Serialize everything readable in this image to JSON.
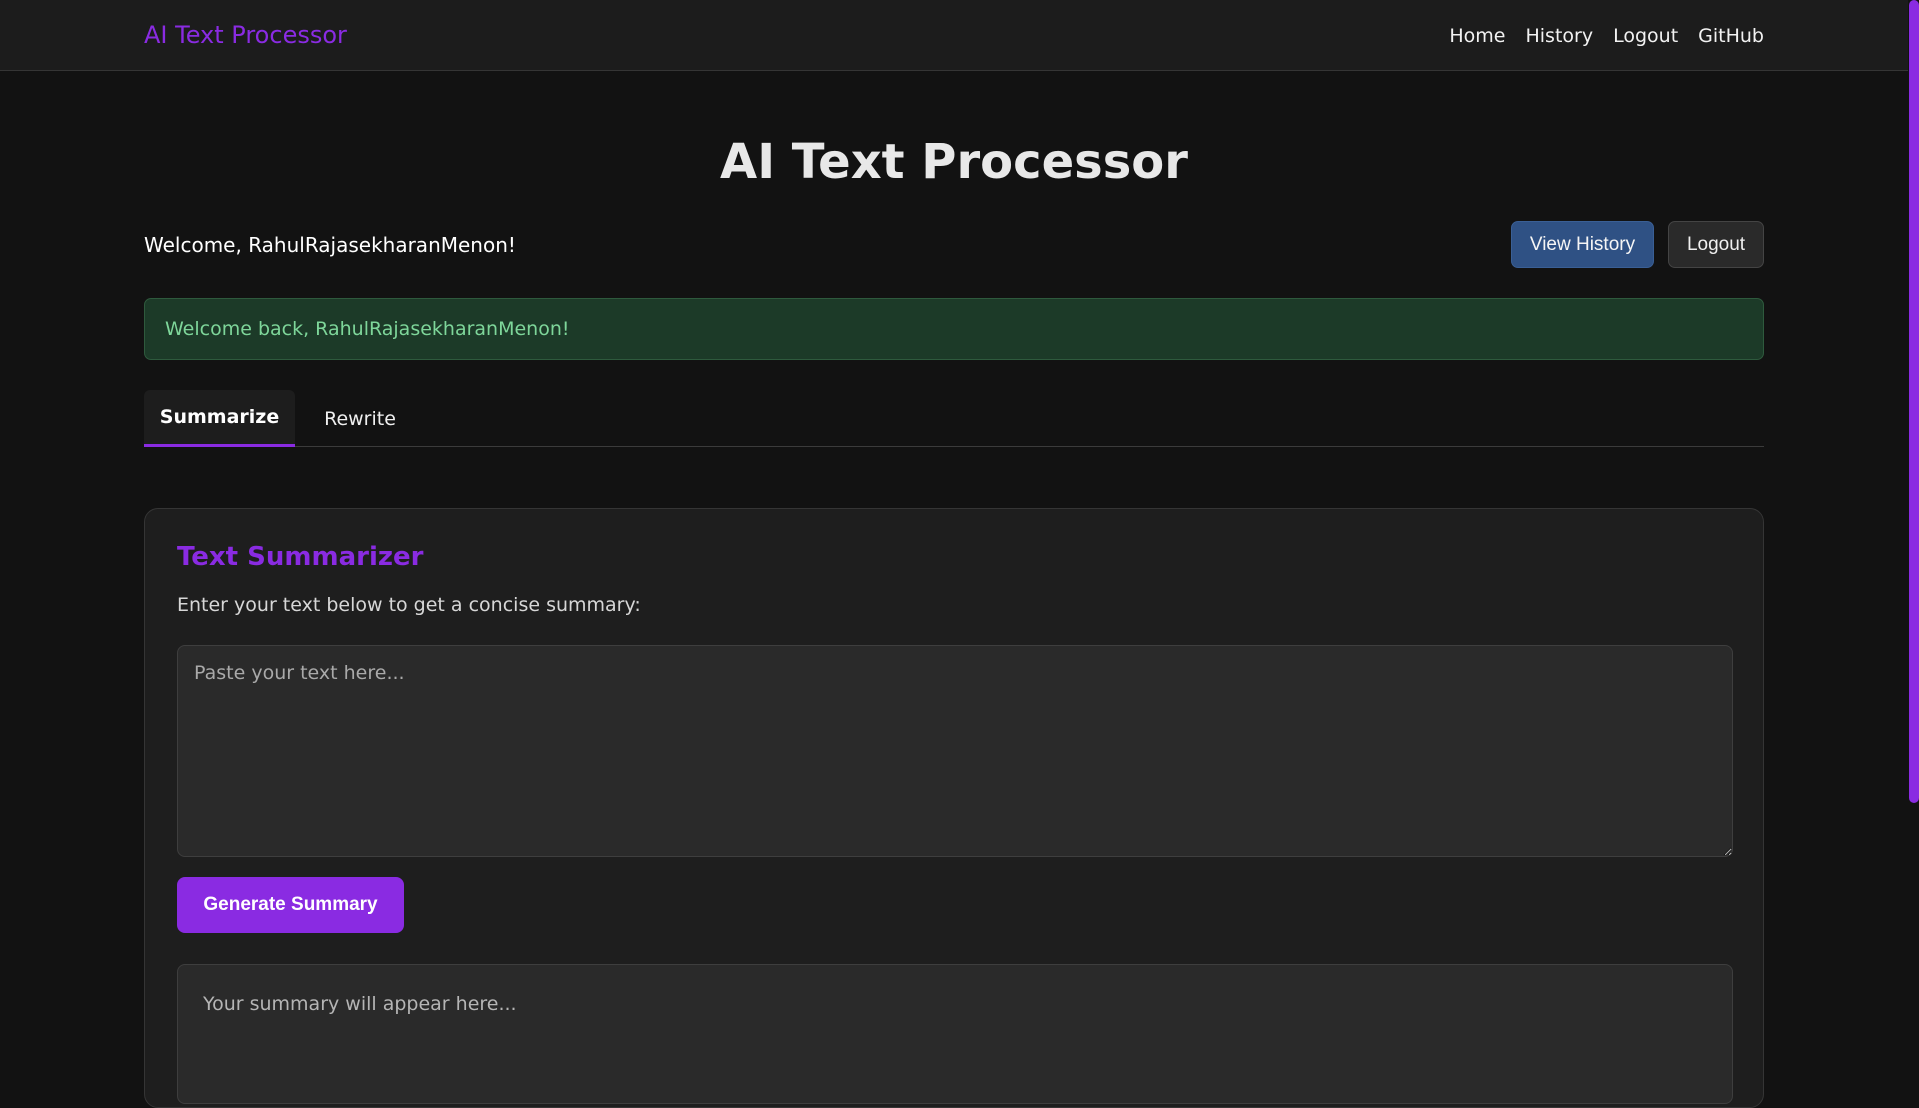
{
  "navbar": {
    "brand": "AI Text Processor",
    "links": [
      "Home",
      "History",
      "Logout",
      "GitHub"
    ]
  },
  "header": {
    "title": "AI Text Processor",
    "welcome": "Welcome, RahulRajasekharanMenon!",
    "view_history_label": "View History",
    "logout_label": "Logout"
  },
  "alert": {
    "message": "Welcome back, RahulRajasekharanMenon!"
  },
  "tabs": [
    {
      "label": "Summarize",
      "active": true
    },
    {
      "label": "Rewrite",
      "active": false
    }
  ],
  "summarizer": {
    "title": "Text Summarizer",
    "description": "Enter your text below to get a concise summary:",
    "input_placeholder": "Paste your text here...",
    "input_value": "",
    "button_label": "Generate Summary",
    "output_placeholder": "Your summary will appear here..."
  },
  "colors": {
    "accent": "#8a2be2",
    "background": "#121212",
    "navbar": "#1c1c1c",
    "history_button": "#2f5184",
    "alert_bg": "#1c3a28",
    "alert_text": "#7ed69a"
  }
}
